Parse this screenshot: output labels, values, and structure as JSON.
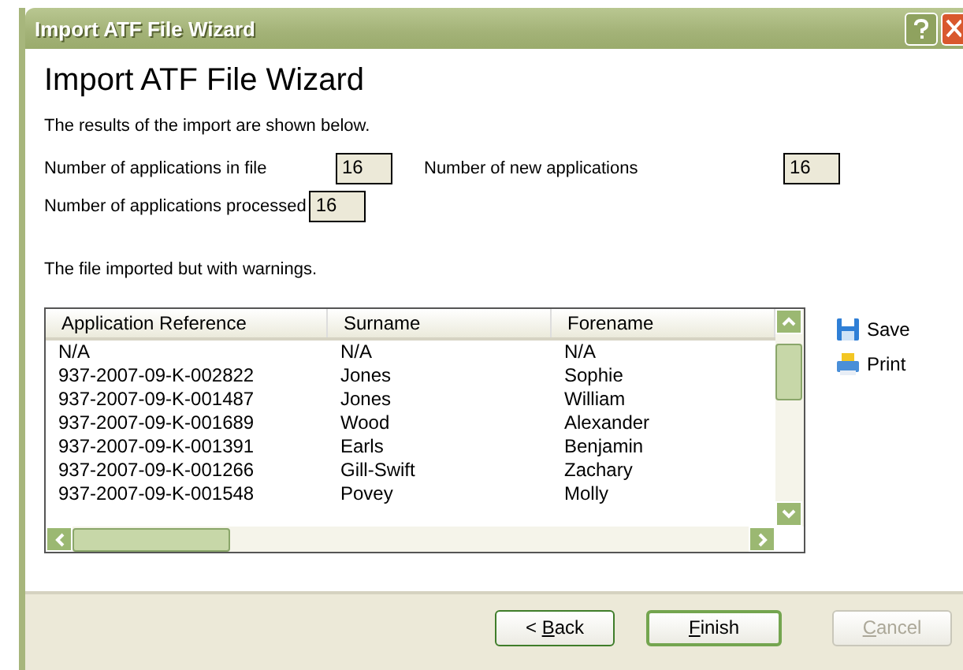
{
  "window": {
    "title": "Import ATF File Wizard"
  },
  "heading": "Import ATF File Wizard",
  "intro": "The results of the import are shown below.",
  "fields": [
    {
      "label": "Number of applications in file",
      "value": "16"
    },
    {
      "label": "Number of new applications",
      "value": "16"
    },
    {
      "label": "Number of applications processed",
      "value": "16"
    }
  ],
  "status": "The file imported but with warnings.",
  "table": {
    "columns": [
      "Application Reference",
      "Surname",
      "Forename"
    ],
    "rows": [
      [
        "N/A",
        "N/A",
        "N/A"
      ],
      [
        "937-2007-09-K-002822",
        "Jones",
        "Sophie"
      ],
      [
        "937-2007-09-K-001487",
        "Jones",
        "William"
      ],
      [
        "937-2007-09-K-001689",
        "Wood",
        "Alexander"
      ],
      [
        "937-2007-09-K-001391",
        "Earls",
        "Benjamin"
      ],
      [
        "937-2007-09-K-001266",
        "Gill-Swift",
        "Zachary"
      ],
      [
        "937-2007-09-K-001548",
        "Povey",
        "Molly"
      ]
    ]
  },
  "actions": [
    {
      "label": "Save",
      "kind": "save"
    },
    {
      "label": "Print",
      "kind": "print"
    }
  ],
  "buttons": [
    {
      "before": "< ",
      "key": "B",
      "after": "ack",
      "disabled": false,
      "default": false
    },
    {
      "key": "F",
      "after": "inish",
      "disabled": false,
      "default": true
    },
    {
      "key": "C",
      "after": "ancel",
      "disabled": true,
      "default": false
    }
  ]
}
